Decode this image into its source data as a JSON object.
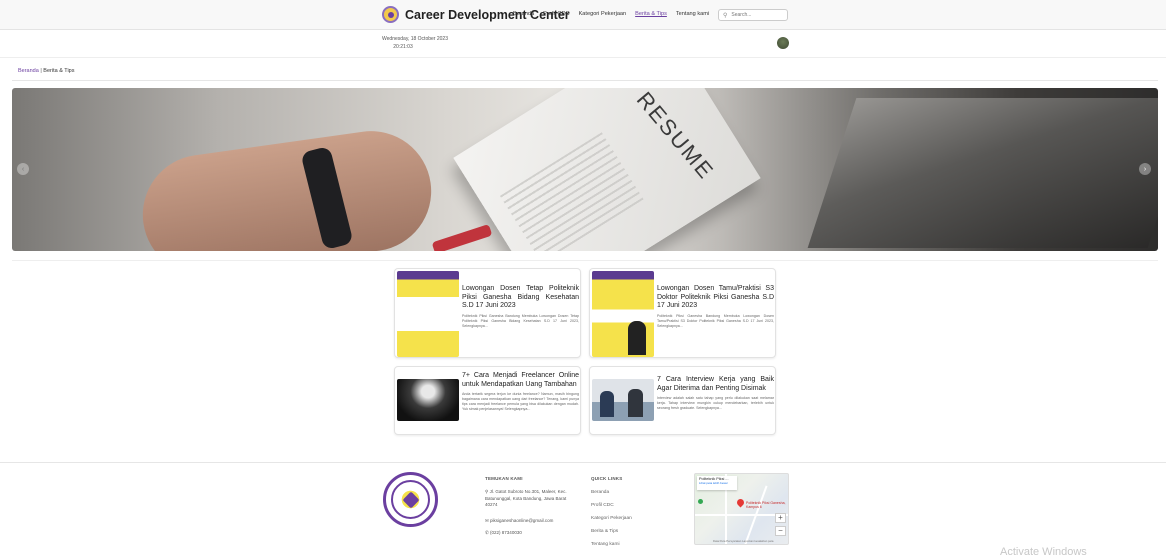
{
  "header": {
    "brand_title": "Career Development Center",
    "nav": [
      "Beranda",
      "Profil CDC",
      "Kategori Pekerjaan",
      "Berita & Tips",
      "Tentang kami"
    ],
    "active_nav_index": 3,
    "search_placeholder": "Search..."
  },
  "datetime": {
    "date": "Wednesday, 18 October 2023",
    "time": "20:21:03"
  },
  "breadcrumb": {
    "home": "Beranda",
    "separator": " | ",
    "current": "Berita & Tips"
  },
  "hero": {
    "text": "RESUME",
    "prev_icon": "‹",
    "next_icon": "›"
  },
  "articles": [
    {
      "title": "Lowongan Dosen Tetap Politeknik Piksi Ganesha Bidang Kesehatan S.D 17 Juni 2023",
      "excerpt": "Politeknik Piksi Ganesha Bandung Membuka Lowongan Dosen Tetap Politeknik Piksi Ganesha Bidang Kesehatan S.D 17 Juni 2023, Selengkapnya..."
    },
    {
      "title": "Lowongan Dosen Tamu/Praktisi S3 Doktor Politeknik Piksi Ganesha S.D 17 Juni 2023",
      "excerpt": "Politeknik Piksi Ganesha Bandung Membuka Lowongan Dosen Tamu/Praktisi S3 Doktor Politeknik Piksi Ganesha S.D 17 Juni 2023, Selengkapnya..."
    },
    {
      "title": "7+ Cara Menjadi Freelancer Online untuk Mendapatkan Uang Tambahan",
      "excerpt": "Anda tertarik segera terjun ke dunia freelance? Namun, masih bingung bagaimana cara mendapatkan uang dari freelance? Tenang, kami punya tips cara menjadi freelance pemula yang bisa dilakukan dengan mudah. Yuk simak penjelasannya! Selengkapnya..."
    },
    {
      "title": "7 Cara Interview Kerja yang Baik Agar Diterima dan Penting Disimak",
      "excerpt": "Interview adalah salah satu tahap yang perlu dilakukan saat melamar kerja. Tahap interview mungkin cukup mendebarkan, terlebih untuk seorang fresh graduate. Selengkapnya..."
    }
  ],
  "footer": {
    "contact_heading": "TEMUKAN KAMI",
    "address": "Jl. Gatot Subroto No.301, Maleer, Kec. Batununggal, Kota Bandung, Jawa Barat 40274",
    "email": "piksiganeshaonline@gmail.com",
    "phone": "(022) 87340030",
    "links_heading": "QUICK LINKS",
    "links": [
      "Beranda",
      "Profil CDC",
      "Kategori Pekerjaan",
      "Berita & Tips",
      "Tentang kami"
    ],
    "map": {
      "card_title": "Politeknik Piksi ...",
      "card_link": "Lihat peta lebih besar",
      "pin_label": "Politeknik Piksi Ganesha, Kampus 6",
      "zoom_in": "+",
      "zoom_out": "−",
      "attribution": "Data Peta  Persyaratan  Laporkan kesalahan peta"
    }
  },
  "watermark": "Activate Windows",
  "colors": {
    "accent": "#6b3fa0",
    "poster_yellow": "#f5e24b"
  }
}
